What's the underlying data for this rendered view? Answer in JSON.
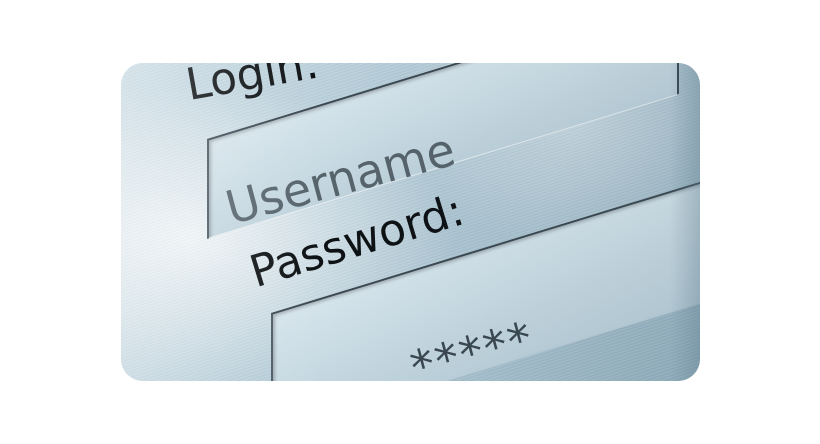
{
  "login_form": {
    "login_label": "Login:",
    "username_placeholder": "Username",
    "password_label": "Password:",
    "password_masked_value": "*****"
  },
  "colors": {
    "screen_light": "#c9dbe4",
    "screen_dark": "#93b0bf",
    "label_text": "#0d1114",
    "placeholder_text": "#56636b",
    "field_border": "#3a4750"
  }
}
